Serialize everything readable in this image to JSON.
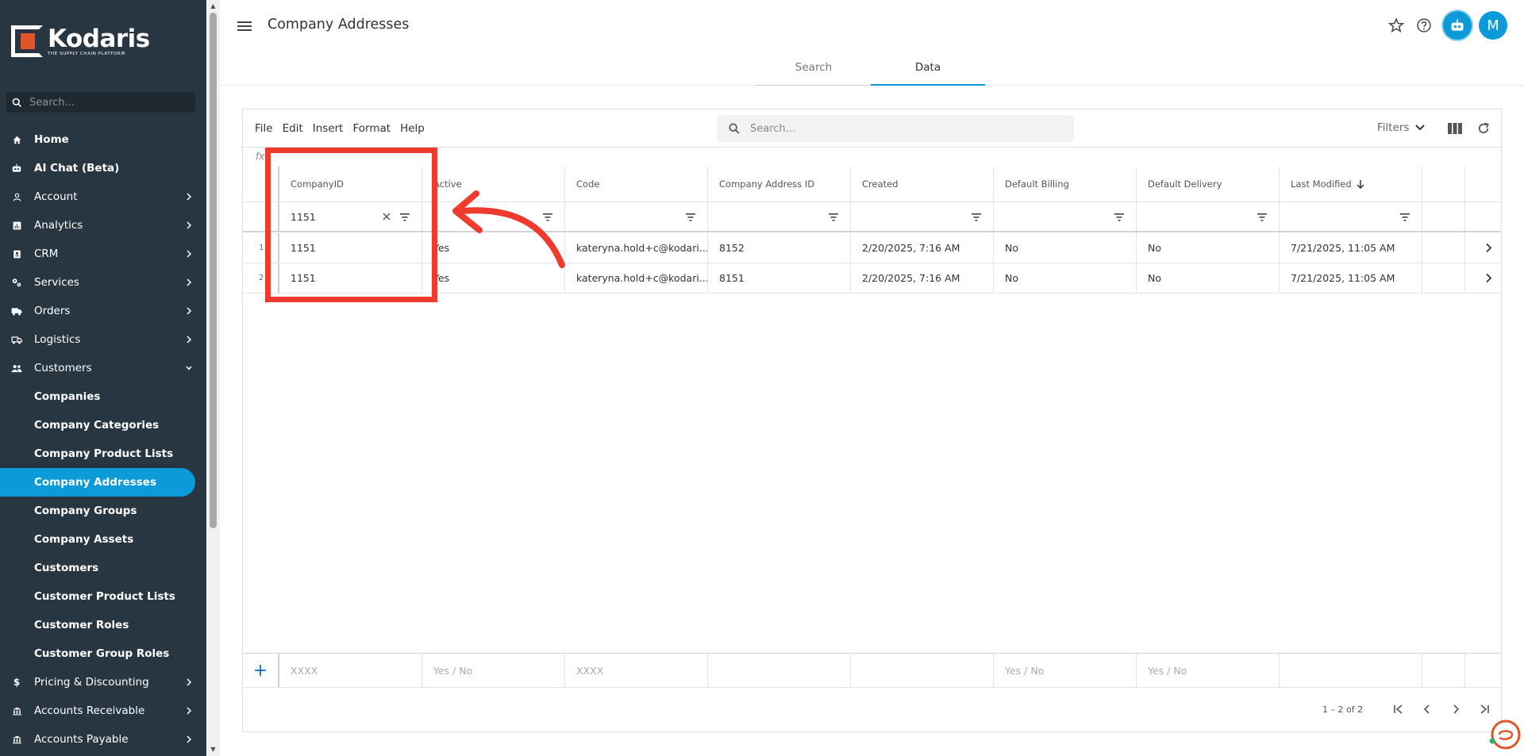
{
  "brand": {
    "name": "Kodaris",
    "tagline": "THE SUPPLY CHAIN PLATFORM"
  },
  "sidebar": {
    "search_placeholder": "Search...",
    "items": [
      {
        "label": "Home",
        "icon": "home-icon",
        "chevron": false
      },
      {
        "label": "AI Chat (Beta)",
        "icon": "robot-icon",
        "chevron": false
      },
      {
        "label": "Account",
        "icon": "person-icon",
        "chevron": true
      },
      {
        "label": "Analytics",
        "icon": "chart-icon",
        "chevron": true
      },
      {
        "label": "CRM",
        "icon": "contact-icon",
        "chevron": true
      },
      {
        "label": "Services",
        "icon": "gears-icon",
        "chevron": true
      },
      {
        "label": "Orders",
        "icon": "truck-icon",
        "chevron": true
      },
      {
        "label": "Logistics",
        "icon": "delivery-icon",
        "chevron": true
      },
      {
        "label": "Customers",
        "icon": "people-icon",
        "chevron": true,
        "expanded": true
      },
      {
        "label": "Companies",
        "sub": true
      },
      {
        "label": "Company Categories",
        "sub": true
      },
      {
        "label": "Company Product Lists",
        "sub": true
      },
      {
        "label": "Company Addresses",
        "sub": true,
        "active": true
      },
      {
        "label": "Company Groups",
        "sub": true
      },
      {
        "label": "Company Assets",
        "sub": true
      },
      {
        "label": "Customers",
        "sub": true
      },
      {
        "label": "Customer Product Lists",
        "sub": true
      },
      {
        "label": "Customer Roles",
        "sub": true
      },
      {
        "label": "Customer Group Roles",
        "sub": true
      },
      {
        "label": "Pricing & Discounting",
        "icon": "dollar-icon",
        "chevron": true
      },
      {
        "label": "Accounts Receivable",
        "icon": "bank-icon",
        "chevron": true
      },
      {
        "label": "Accounts Payable",
        "icon": "bank-icon",
        "chevron": true
      }
    ]
  },
  "header": {
    "title": "Company Addresses",
    "tabs": [
      {
        "label": "Search",
        "active": false
      },
      {
        "label": "Data",
        "active": true
      }
    ],
    "avatar_initial": "M"
  },
  "toolbar": {
    "menu": [
      "File",
      "Edit",
      "Insert",
      "Format",
      "Help"
    ],
    "search_placeholder": "Search...",
    "filters_label": "Filters"
  },
  "grid": {
    "fx": "fx",
    "columns": [
      "CompanyID",
      "Active",
      "Code",
      "Company Address ID",
      "Created",
      "Default Billing",
      "Default Delivery",
      "Last Modified"
    ],
    "filter_values": [
      "1151",
      "",
      "",
      "",
      "",
      "",
      "",
      ""
    ],
    "rows": [
      {
        "index": "1",
        "cells": [
          "1151",
          "Yes",
          "kateryna.hold+c@kodari...",
          "8152",
          "2/20/2025, 7:16 AM",
          "No",
          "No",
          "7/21/2025, 11:05 AM"
        ]
      },
      {
        "index": "2",
        "cells": [
          "1151",
          "Yes",
          "kateryna.hold+c@kodari...",
          "8151",
          "2/20/2025, 7:16 AM",
          "No",
          "No",
          "7/21/2025, 11:05 AM"
        ]
      }
    ],
    "insert_placeholders": [
      "XXXX",
      "Yes / No",
      "XXXX",
      "",
      "",
      "Yes / No",
      "Yes / No",
      ""
    ],
    "pager": "1 – 2 of 2"
  },
  "colors": {
    "sidebar_bg": "#283642",
    "accent": "#0d9ad8",
    "annotation": "#ef3b2d",
    "brand_orange": "#e0562a"
  }
}
